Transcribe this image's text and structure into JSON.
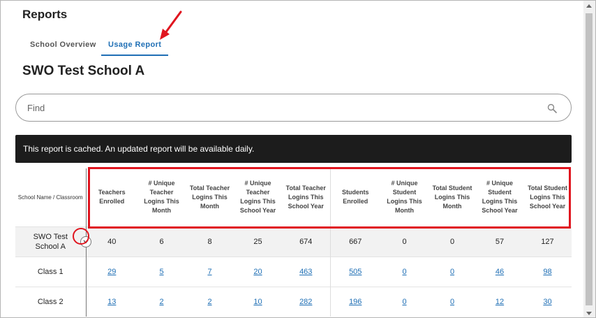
{
  "header": {
    "title": "Reports"
  },
  "tabs": [
    {
      "label": "School Overview",
      "active": false
    },
    {
      "label": "Usage Report",
      "active": true
    }
  ],
  "school_title": "SWO Test School A",
  "search": {
    "placeholder": "Find",
    "value": ""
  },
  "banner": {
    "text": "This report is cached. An updated report will be available daily."
  },
  "table": {
    "columns": [
      "School Name / Classroom",
      "Teachers Enrolled",
      "# Unique Teacher Logins This Month",
      "Total Teacher Logins This Month",
      "# Unique Teacher Logins This School Year",
      "Total Teacher Logins This School Year",
      "Students Enrolled",
      "# Unique Student Logins This Month",
      "Total Student Logins This Month",
      "# Unique Student Logins This School Year",
      "Total Student Logins This School Year"
    ],
    "rows": [
      {
        "name": "SWO Test School A",
        "values": [
          "40",
          "6",
          "8",
          "25",
          "674",
          "667",
          "0",
          "0",
          "57",
          "127"
        ]
      },
      {
        "name": "Class 1",
        "values": [
          "29",
          "5",
          "7",
          "20",
          "463",
          "505",
          "0",
          "0",
          "46",
          "98"
        ]
      },
      {
        "name": "Class 2",
        "values": [
          "13",
          "2",
          "2",
          "10",
          "282",
          "196",
          "0",
          "0",
          "12",
          "30"
        ]
      }
    ]
  },
  "colors": {
    "accent": "#1f6fb5",
    "annotation": "#e0151f",
    "banner_bg": "#1c1c1c"
  },
  "icons": {
    "search": "search-icon",
    "expand": "chevron-down-icon"
  }
}
